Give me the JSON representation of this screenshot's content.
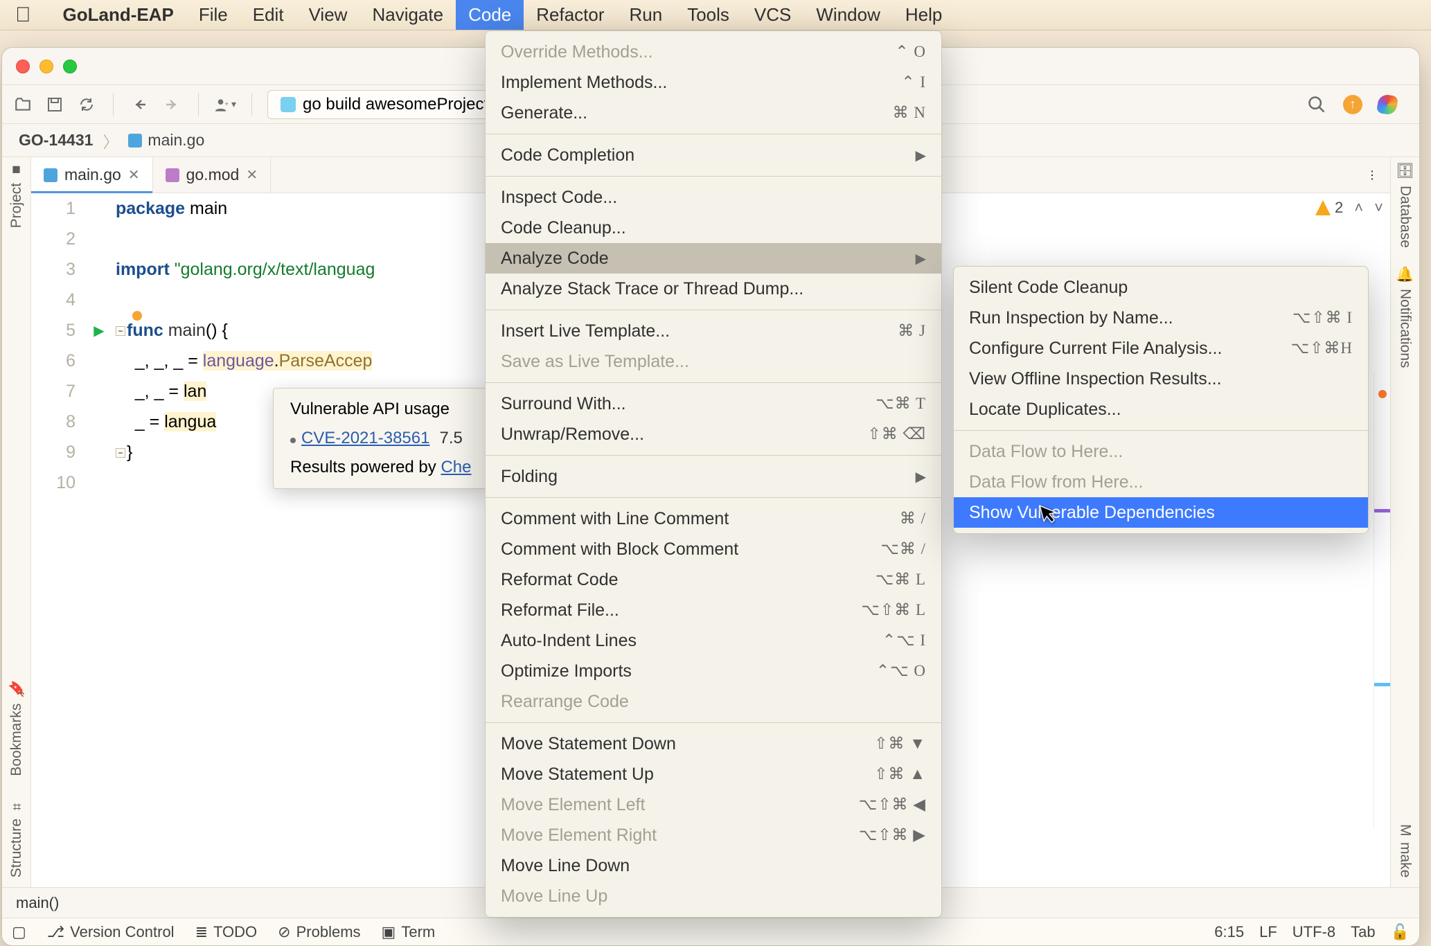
{
  "mac_menu": {
    "app": "GoLand-EAP",
    "items": [
      "File",
      "Edit",
      "View",
      "Navigate",
      "Code",
      "Refactor",
      "Run",
      "Tools",
      "VCS",
      "Window",
      "Help"
    ],
    "selected": "Code"
  },
  "toolbar": {
    "run_config": "go build awesomeProject"
  },
  "breadcrumbs": {
    "project": "GO-14431",
    "file": "main.go"
  },
  "tabs": [
    {
      "label": "main.go",
      "active": true
    },
    {
      "label": "go.mod",
      "active": false
    }
  ],
  "code": {
    "lines": [
      "package main",
      "",
      "import \"golang.org/x/text/languag",
      "",
      "func main() {",
      "    _, _, _ = language.ParseAccep",
      "    _, _ = lan",
      "    _ = langua",
      "}",
      ""
    ]
  },
  "inspections": {
    "warnings": "2"
  },
  "tooltip": {
    "title": "Vulnerable API usage",
    "cve": "CVE-2021-38561",
    "score": "7.5",
    "footer_prefix": "Results powered by ",
    "footer_link": "Che"
  },
  "menu_code": [
    {
      "label": "Override Methods...",
      "shortcut": "⌃ O",
      "disabled": true
    },
    {
      "label": "Implement Methods...",
      "shortcut": "⌃ I"
    },
    {
      "label": "Generate...",
      "shortcut": "⌘ N"
    },
    {
      "sep": true
    },
    {
      "label": "Code Completion",
      "sub": true
    },
    {
      "sep": true
    },
    {
      "label": "Inspect Code..."
    },
    {
      "label": "Code Cleanup..."
    },
    {
      "label": "Analyze Code",
      "sub": true,
      "hover": true
    },
    {
      "label": "Analyze Stack Trace or Thread Dump..."
    },
    {
      "sep": true
    },
    {
      "label": "Insert Live Template...",
      "shortcut": "⌘ J"
    },
    {
      "label": "Save as Live Template...",
      "disabled": true
    },
    {
      "sep": true
    },
    {
      "label": "Surround With...",
      "shortcut": "⌥⌘ T"
    },
    {
      "label": "Unwrap/Remove...",
      "shortcut": "⇧⌘ ⌫"
    },
    {
      "sep": true
    },
    {
      "label": "Folding",
      "sub": true
    },
    {
      "sep": true
    },
    {
      "label": "Comment with Line Comment",
      "shortcut": "⌘ /"
    },
    {
      "label": "Comment with Block Comment",
      "shortcut": "⌥⌘ /"
    },
    {
      "label": "Reformat Code",
      "shortcut": "⌥⌘ L"
    },
    {
      "label": "Reformat File...",
      "shortcut": "⌥⇧⌘ L"
    },
    {
      "label": "Auto-Indent Lines",
      "shortcut": "⌃⌥ I"
    },
    {
      "label": "Optimize Imports",
      "shortcut": "⌃⌥ O"
    },
    {
      "label": "Rearrange Code",
      "disabled": true
    },
    {
      "sep": true
    },
    {
      "label": "Move Statement Down",
      "shortcut": "⇧⌘ ▼"
    },
    {
      "label": "Move Statement Up",
      "shortcut": "⇧⌘ ▲"
    },
    {
      "label": "Move Element Left",
      "shortcut": "⌥⇧⌘ ◀",
      "disabled": true
    },
    {
      "label": "Move Element Right",
      "shortcut": "⌥⇧⌘ ▶",
      "disabled": true
    },
    {
      "label": "Move Line Down",
      "shortcut": ""
    },
    {
      "label": "Move Line Up",
      "shortcut": "",
      "disabled": true
    }
  ],
  "menu_analyze": [
    {
      "label": "Silent Code Cleanup"
    },
    {
      "label": "Run Inspection by Name...",
      "shortcut": "⌥⇧⌘ I"
    },
    {
      "label": "Configure Current File Analysis...",
      "shortcut": "⌥⇧⌘H"
    },
    {
      "label": "View Offline Inspection Results..."
    },
    {
      "label": "Locate Duplicates..."
    },
    {
      "sep": true
    },
    {
      "label": "Data Flow to Here...",
      "disabled": true
    },
    {
      "label": "Data Flow from Here...",
      "disabled": true
    },
    {
      "label": "Show Vulnerable Dependencies",
      "hi": true
    }
  ],
  "left_tools": [
    "Project",
    "Bookmarks",
    "Structure"
  ],
  "right_tools": [
    "Database",
    "Notifications",
    "make"
  ],
  "bottom_crumb": "main()",
  "bottom_tools": [
    "Version Control",
    "TODO",
    "Problems",
    "Term"
  ],
  "status": {
    "pos": "6:15",
    "enc": "LF",
    "charset": "UTF-8",
    "indent": "Tab"
  }
}
